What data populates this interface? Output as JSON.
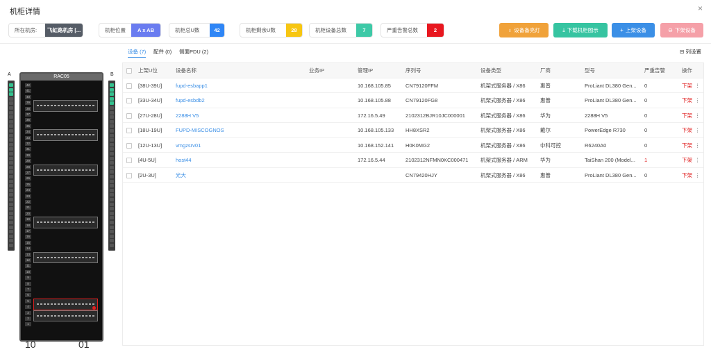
{
  "header": {
    "title": "机柜详情",
    "close": "×"
  },
  "stats": [
    {
      "label": "所在机房:",
      "value": "飞虹路机房 [...",
      "color": "#555c66"
    },
    {
      "label": "机柜位置",
      "value": "A x AB",
      "color": "#6a7cf0"
    },
    {
      "label": "机柜总U数",
      "value": "42",
      "color": "#2f86f6"
    },
    {
      "label": "机柜剩余U数",
      "value": "28",
      "color": "#f7c612"
    },
    {
      "label": "机柜设备总数",
      "value": "7",
      "color": "#3ec9a7"
    },
    {
      "label": "严重告警总数",
      "value": "2",
      "color": "#e8171f"
    }
  ],
  "actions": {
    "locate": {
      "label": "设备备亮灯",
      "icon": "♁",
      "color": "#f0a23a"
    },
    "download": {
      "label": "下载机柜图示",
      "icon": "⤓",
      "color": "#36c4a1"
    },
    "mount": {
      "label": "上架设备",
      "icon": "+",
      "color": "#3b8fe6"
    },
    "unmount": {
      "label": "下架设备",
      "icon": "⊖",
      "color": "#f5a0a8"
    }
  },
  "rack": {
    "name": "RAC05",
    "side_a": "A",
    "side_b": "B",
    "total_u": 42,
    "foot_left": "10",
    "foot_right": "01"
  },
  "tabs": [
    {
      "label": "设备 (7)"
    },
    {
      "label": "配件 (0)"
    },
    {
      "label": "侧面PDU (2)"
    }
  ],
  "column_settings": "列设置",
  "table": {
    "columns": [
      "上架U位",
      "设备名称",
      "业务IP",
      "管理IP",
      "序列号",
      "设备类型",
      "厂商",
      "型号",
      "严重告警",
      "操作"
    ],
    "rows": [
      [
        "[38U-39U]",
        "fupd-esbapp1",
        "",
        "10.168.105.85",
        "CN79120FFM",
        "机架式服务器 / X86",
        "惠普",
        "ProLiant DL380 Gen...",
        "0"
      ],
      [
        "[33U-34U]",
        "fupd-esbdb2",
        "",
        "10.168.105.88",
        "CN79120FG8",
        "机架式服务器 / X86",
        "惠普",
        "ProLiant DL380 Gen...",
        "0"
      ],
      [
        "[27U-28U]",
        "2288H V5",
        "",
        "172.16.5.49",
        "2102312BJR10JC000001",
        "机架式服务器 / X86",
        "华为",
        "2288H V5",
        "0"
      ],
      [
        "[18U-19U]",
        "FUPD-MISCOGNOS",
        "",
        "10.168.105.133",
        "HH8XSR2",
        "机架式服务器 / X86",
        "戴尔",
        "PowerEdge R730",
        "0"
      ],
      [
        "[12U-13U]",
        "vmgzsrv01",
        "",
        "10.168.152.141",
        "H0K0MG2",
        "机架式服务器 / X86",
        "中科可控",
        "R6240A0",
        "0"
      ],
      [
        "[4U-5U]",
        "host44",
        "",
        "172.16.5.44",
        "2102312NFMN0KC000471",
        "机架式服务器 / ARM",
        "华为",
        "TaiShan 200 (Model...",
        "1"
      ],
      [
        "[2U-3U]",
        "光大",
        "",
        "",
        "CN79420HJY",
        "机架式服务器 / X86",
        "惠普",
        "ProLiant DL380 Gen...",
        "0"
      ]
    ],
    "op_delete": "下架",
    "op_more": "⋮"
  }
}
